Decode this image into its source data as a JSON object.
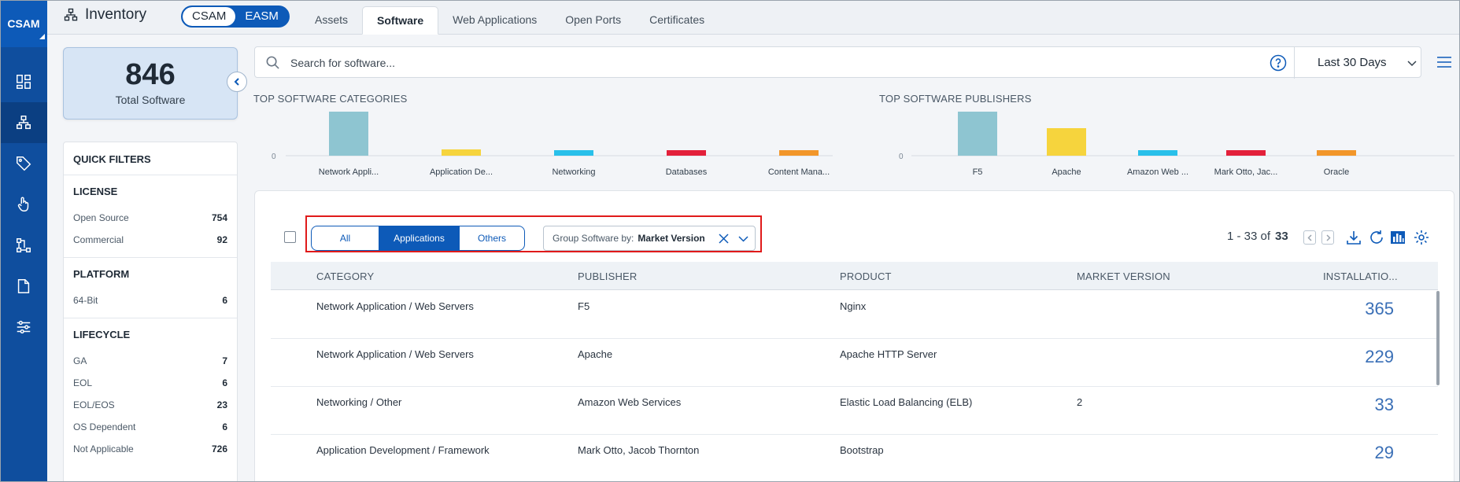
{
  "rail": {
    "brand": "CSAM",
    "items": [
      {
        "icon": "dashboard-icon"
      },
      {
        "icon": "inventory-icon"
      },
      {
        "icon": "tag-icon"
      },
      {
        "icon": "touch-icon"
      },
      {
        "icon": "network-icon"
      },
      {
        "icon": "document-icon"
      },
      {
        "icon": "sliders-icon"
      }
    ]
  },
  "header": {
    "title": "Inventory",
    "toggle": {
      "left": "CSAM",
      "right": "EASM"
    },
    "tabs": [
      "Assets",
      "Software",
      "Web Applications",
      "Open Ports",
      "Certificates"
    ],
    "active_tab": "Software"
  },
  "stat": {
    "value": "846",
    "label": "Total Software"
  },
  "search": {
    "placeholder": "Search for software...",
    "range": "Last 30 Days"
  },
  "quick_filters": {
    "title": "QUICK FILTERS",
    "sections": [
      {
        "title": "LICENSE",
        "rows": [
          {
            "label": "Open Source",
            "count": "754"
          },
          {
            "label": "Commercial",
            "count": "92"
          }
        ]
      },
      {
        "title": "PLATFORM",
        "rows": [
          {
            "label": "64-Bit",
            "count": "6"
          }
        ]
      },
      {
        "title": "LIFECYCLE",
        "rows": [
          {
            "label": "GA",
            "count": "7"
          },
          {
            "label": "EOL",
            "count": "6"
          },
          {
            "label": "EOL/EOS",
            "count": "23"
          },
          {
            "label": "OS Dependent",
            "count": "6"
          },
          {
            "label": "Not Applicable",
            "count": "726"
          }
        ]
      }
    ]
  },
  "chart_data": [
    {
      "type": "bar",
      "title": "TOP SOFTWARE CATEGORIES",
      "categories": [
        "Network Appli...",
        "Application De...",
        "Networking",
        "Databases",
        "Content Mana..."
      ],
      "values": [
        365,
        53,
        38,
        38,
        38
      ],
      "colors": [
        "#8ec5d1",
        "#f6d43d",
        "#29c0ea",
        "#e3203a",
        "#f2962a"
      ],
      "yticks": [
        "0"
      ]
    },
    {
      "type": "bar",
      "title": "TOP SOFTWARE PUBLISHERS",
      "categories": [
        "F5",
        "Apache",
        "Amazon Web ...",
        "Mark Otto, Jac...",
        "Oracle"
      ],
      "values": [
        365,
        229,
        33,
        29,
        29
      ],
      "colors": [
        "#8ec5d1",
        "#f6d43d",
        "#29c0ea",
        "#e3203a",
        "#f2962a"
      ],
      "yticks": [
        "0"
      ]
    }
  ],
  "toolbar": {
    "segments": [
      "All",
      "Applications",
      "Others"
    ],
    "active_segment": "Applications",
    "group_label": "Group Software by:",
    "group_value": "Market Version",
    "pager_range": "1 - 33 of",
    "pager_total": "33"
  },
  "table": {
    "columns": [
      "CATEGORY",
      "PUBLISHER",
      "PRODUCT",
      "MARKET VERSION",
      "INSTALLATIO..."
    ],
    "rows": [
      {
        "category": "Network Application / Web Servers",
        "publisher": "F5",
        "product": "Nginx",
        "version": "",
        "installations": "365"
      },
      {
        "category": "Network Application / Web Servers",
        "publisher": "Apache",
        "product": "Apache HTTP Server",
        "version": "",
        "installations": "229"
      },
      {
        "category": "Networking / Other",
        "publisher": "Amazon Web Services",
        "product": "Elastic Load Balancing (ELB)",
        "version": "2",
        "installations": "33"
      },
      {
        "category": "Application Development / Framework",
        "publisher": "Mark Otto, Jacob Thornton",
        "product": "Bootstrap",
        "version": "",
        "installations": "29"
      }
    ]
  }
}
